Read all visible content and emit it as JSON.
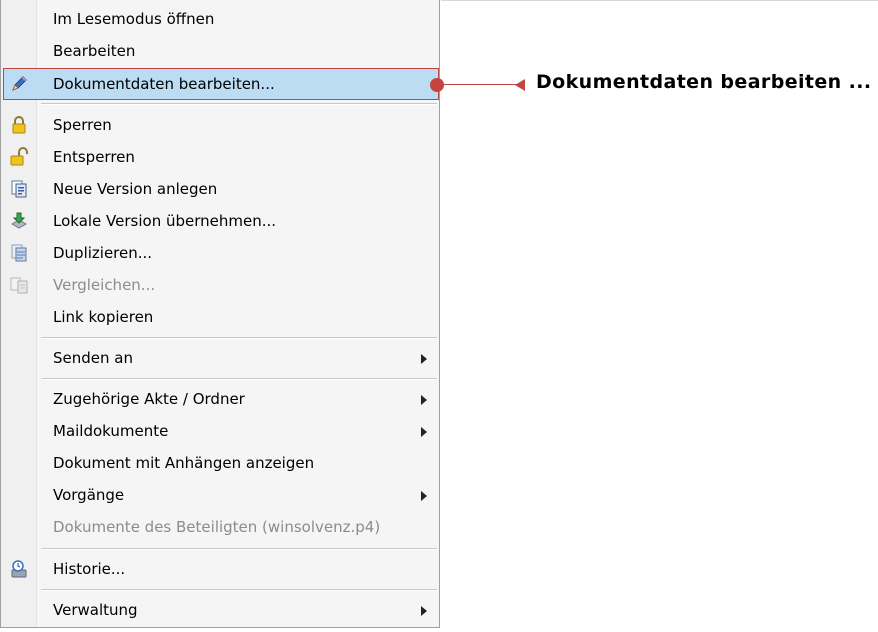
{
  "menu": {
    "items": [
      {
        "label": "Im Lesemodus öffnen",
        "icon": "",
        "submenu": false,
        "disabled": false
      },
      {
        "label": "Bearbeiten",
        "icon": "",
        "submenu": false,
        "disabled": false
      },
      {
        "label": "Dokumentdaten bearbeiten...",
        "icon": "pencil-icon",
        "submenu": false,
        "disabled": false,
        "highlighted": true
      },
      {
        "label": "Sperren",
        "icon": "lock-closed-icon",
        "submenu": false,
        "disabled": false
      },
      {
        "label": "Entsperren",
        "icon": "lock-open-icon",
        "submenu": false,
        "disabled": false
      },
      {
        "label": "Neue Version anlegen",
        "icon": "new-version-icon",
        "submenu": false,
        "disabled": false
      },
      {
        "label": "Lokale Version übernehmen...",
        "icon": "import-version-icon",
        "submenu": false,
        "disabled": false
      },
      {
        "label": "Duplizieren...",
        "icon": "duplicate-icon",
        "submenu": false,
        "disabled": false
      },
      {
        "label": "Vergleichen...",
        "icon": "compare-icon",
        "submenu": false,
        "disabled": true
      },
      {
        "label": "Link kopieren",
        "icon": "",
        "submenu": false,
        "disabled": false
      },
      {
        "label": "Senden an",
        "icon": "",
        "submenu": true,
        "disabled": false
      },
      {
        "label": "Zugehörige Akte / Ordner",
        "icon": "",
        "submenu": true,
        "disabled": false
      },
      {
        "label": "Maildokumente",
        "icon": "",
        "submenu": true,
        "disabled": false
      },
      {
        "label": "Dokument mit Anhängen anzeigen",
        "icon": "",
        "submenu": false,
        "disabled": false
      },
      {
        "label": "Vorgänge",
        "icon": "",
        "submenu": true,
        "disabled": false
      },
      {
        "label": "Dokumente des Beteiligten (winsolvenz.p4)",
        "icon": "",
        "submenu": false,
        "disabled": true
      },
      {
        "label": "Historie...",
        "icon": "history-icon",
        "submenu": false,
        "disabled": false
      },
      {
        "label": "Verwaltung",
        "icon": "",
        "submenu": true,
        "disabled": false
      }
    ]
  },
  "callout": {
    "text": "Dokumentdaten  bearbeiten ...",
    "color": "#c3453f"
  },
  "colors": {
    "highlight_bg": "#bcdcf4",
    "highlight_border": "#c3453f",
    "disabled_text": "#8c8c8c"
  }
}
